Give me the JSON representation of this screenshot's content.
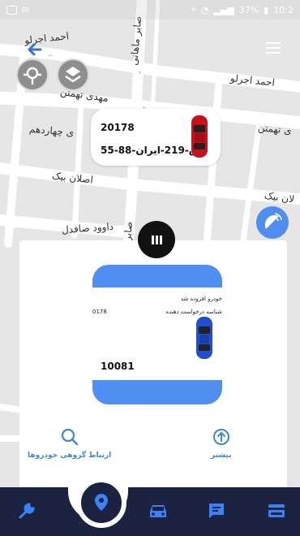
{
  "status_bar": {
    "battery": "37%",
    "time": "10:2"
  },
  "map": {
    "street_labels": [
      "احمد اجرلو",
      "صابر ماهانی",
      "احمد اجرلو",
      "مهدی تهمتن",
      "ی تهمتن",
      "ی چهاردهم",
      "اصلان بیک",
      "لان بیک",
      "داوود صافدل",
      "صابر"
    ]
  },
  "car_card": {
    "id": "20178",
    "plate": "55-ق-219-ایران-88",
    "color": "#c8101a"
  },
  "info_card": {
    "line1": "خودرو افزوده شد",
    "line2": "شناسه درخواست دهنده",
    "left_num": "0178",
    "number": "10081",
    "car_color": "#1f4fd0"
  },
  "actions": {
    "more_label": "بیشتر",
    "group_label": "ارتباط گروهی خودروها"
  },
  "colors": {
    "accent": "#3a88d6",
    "nav_bg": "#1b2340",
    "nav_icon": "#3b82f6"
  }
}
